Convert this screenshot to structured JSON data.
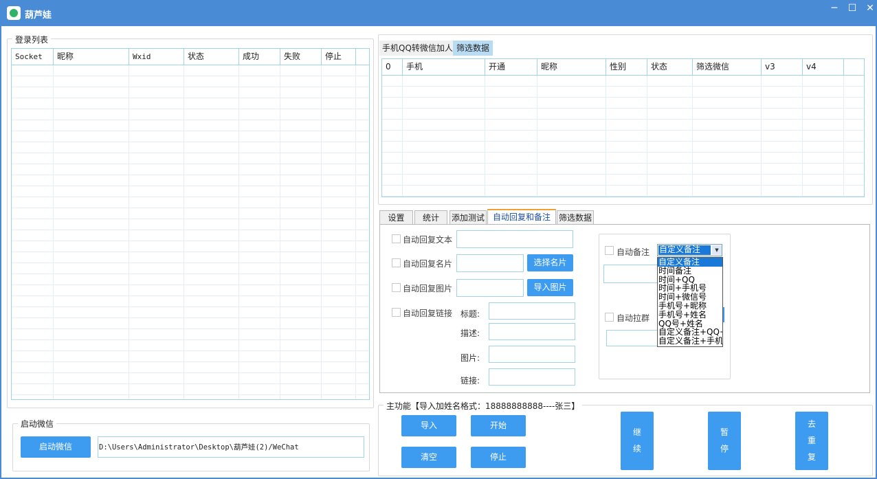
{
  "window": {
    "title": "葫芦娃",
    "minimize": "─",
    "maximize": "☐",
    "close": "✕"
  },
  "login_list": {
    "title": "登录列表",
    "columns": [
      "Socket",
      "昵称",
      "Wxid",
      "状态",
      "成功",
      "失败",
      "停止"
    ]
  },
  "start_wechat": {
    "title": "启动微信",
    "button": "启动微信",
    "path": "D:\\Users\\Administrator\\Desktop\\葫芦娃(2)/WeChat"
  },
  "top_tabs": [
    "手机QQ转微信加人",
    "筛选数据"
  ],
  "data_grid": {
    "columns": [
      "0",
      "手机",
      "开通",
      "昵称",
      "性别",
      "状态",
      "筛选微信",
      "v3",
      "v4"
    ]
  },
  "sub_tabs": [
    "设置",
    "统计",
    "添加测试",
    "自动回复和备注",
    "筛选数据"
  ],
  "auto_reply": {
    "text_label": "自动回复文本",
    "card_label": "自动回复名片",
    "card_button": "选择名片",
    "image_label": "自动回复图片",
    "image_button": "导入图片",
    "link_label": "自动回复链接",
    "title_label": "标题:",
    "desc_label": "描述:",
    "pic_label": "图片:",
    "url_label": "链接:"
  },
  "auto_note": {
    "label": "自动备注",
    "selected": "自定义备注",
    "options": [
      "自定义备注",
      "时间备注",
      "时间+QQ",
      "时间+手机号",
      "时间+微信号",
      "手机号+昵称",
      "手机号+姓名",
      "QQ号+姓名",
      "自定义备注+QQ+F",
      "自定义备注+手机"
    ],
    "group_label": "自动拉群"
  },
  "main_func": {
    "title": "主功能【导入加姓名格式：18888888888----张三】",
    "import": "导入",
    "start": "开始",
    "clear": "清空",
    "stop": "停止",
    "continue": "继\n续",
    "pause": "暂\n停",
    "dedupe": "去\n重\n复"
  }
}
